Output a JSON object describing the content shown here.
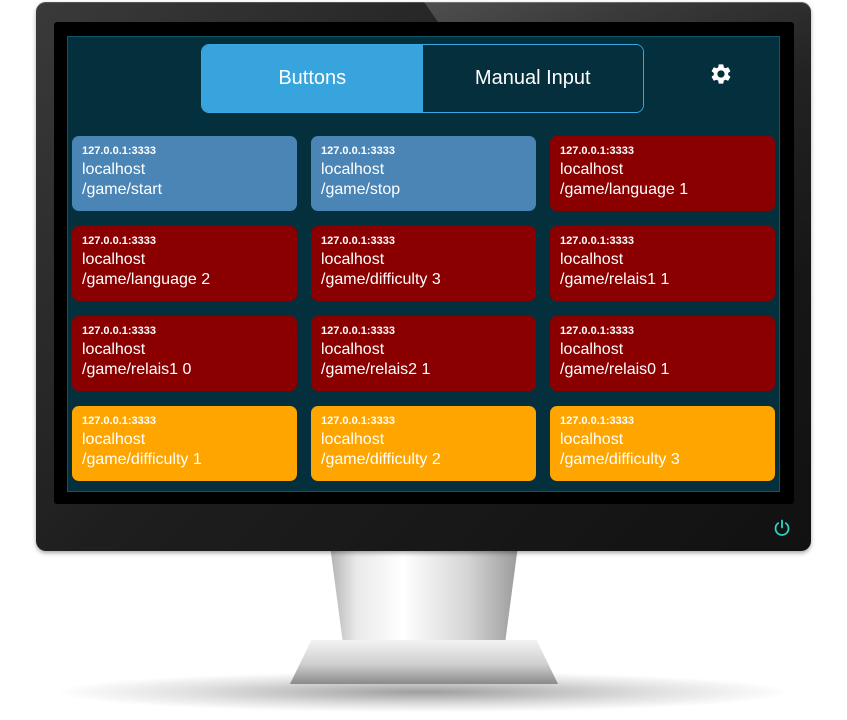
{
  "tabs": [
    {
      "label": "Buttons",
      "active": true
    },
    {
      "label": "Manual Input",
      "active": false
    }
  ],
  "settings_icon": "gear-icon",
  "power_icon": "power-icon",
  "colors": {
    "screen_bg": "#04303d",
    "tab_active": "#38a4dd",
    "blue": "#4a85b5",
    "red": "#8a0000",
    "orange": "#ffa500"
  },
  "buttons": [
    {
      "address": "127.0.0.1:3333",
      "host": "localhost",
      "path": "/game/start",
      "color": "#4a85b5"
    },
    {
      "address": "127.0.0.1:3333",
      "host": "localhost",
      "path": "/game/stop",
      "color": "#4a85b5"
    },
    {
      "address": "127.0.0.1:3333",
      "host": "localhost",
      "path": "/game/language 1",
      "color": "#8a0000"
    },
    {
      "address": "127.0.0.1:3333",
      "host": "localhost",
      "path": "/game/language 2",
      "color": "#8a0000"
    },
    {
      "address": "127.0.0.1:3333",
      "host": "localhost",
      "path": "/game/difficulty 3",
      "color": "#8a0000"
    },
    {
      "address": "127.0.0.1:3333",
      "host": "localhost",
      "path": "/game/relais1 1",
      "color": "#8a0000"
    },
    {
      "address": "127.0.0.1:3333",
      "host": "localhost",
      "path": "/game/relais1 0",
      "color": "#8a0000"
    },
    {
      "address": "127.0.0.1:3333",
      "host": "localhost",
      "path": "/game/relais2 1",
      "color": "#8a0000"
    },
    {
      "address": "127.0.0.1:3333",
      "host": "localhost",
      "path": "/game/relais0 1",
      "color": "#8a0000"
    },
    {
      "address": "127.0.0.1:3333",
      "host": "localhost",
      "path": "/game/difficulty 1",
      "color": "#ffa500"
    },
    {
      "address": "127.0.0.1:3333",
      "host": "localhost",
      "path": "/game/difficulty 2",
      "color": "#ffa500"
    },
    {
      "address": "127.0.0.1:3333",
      "host": "localhost",
      "path": "/game/difficulty 3",
      "color": "#ffa500"
    }
  ]
}
